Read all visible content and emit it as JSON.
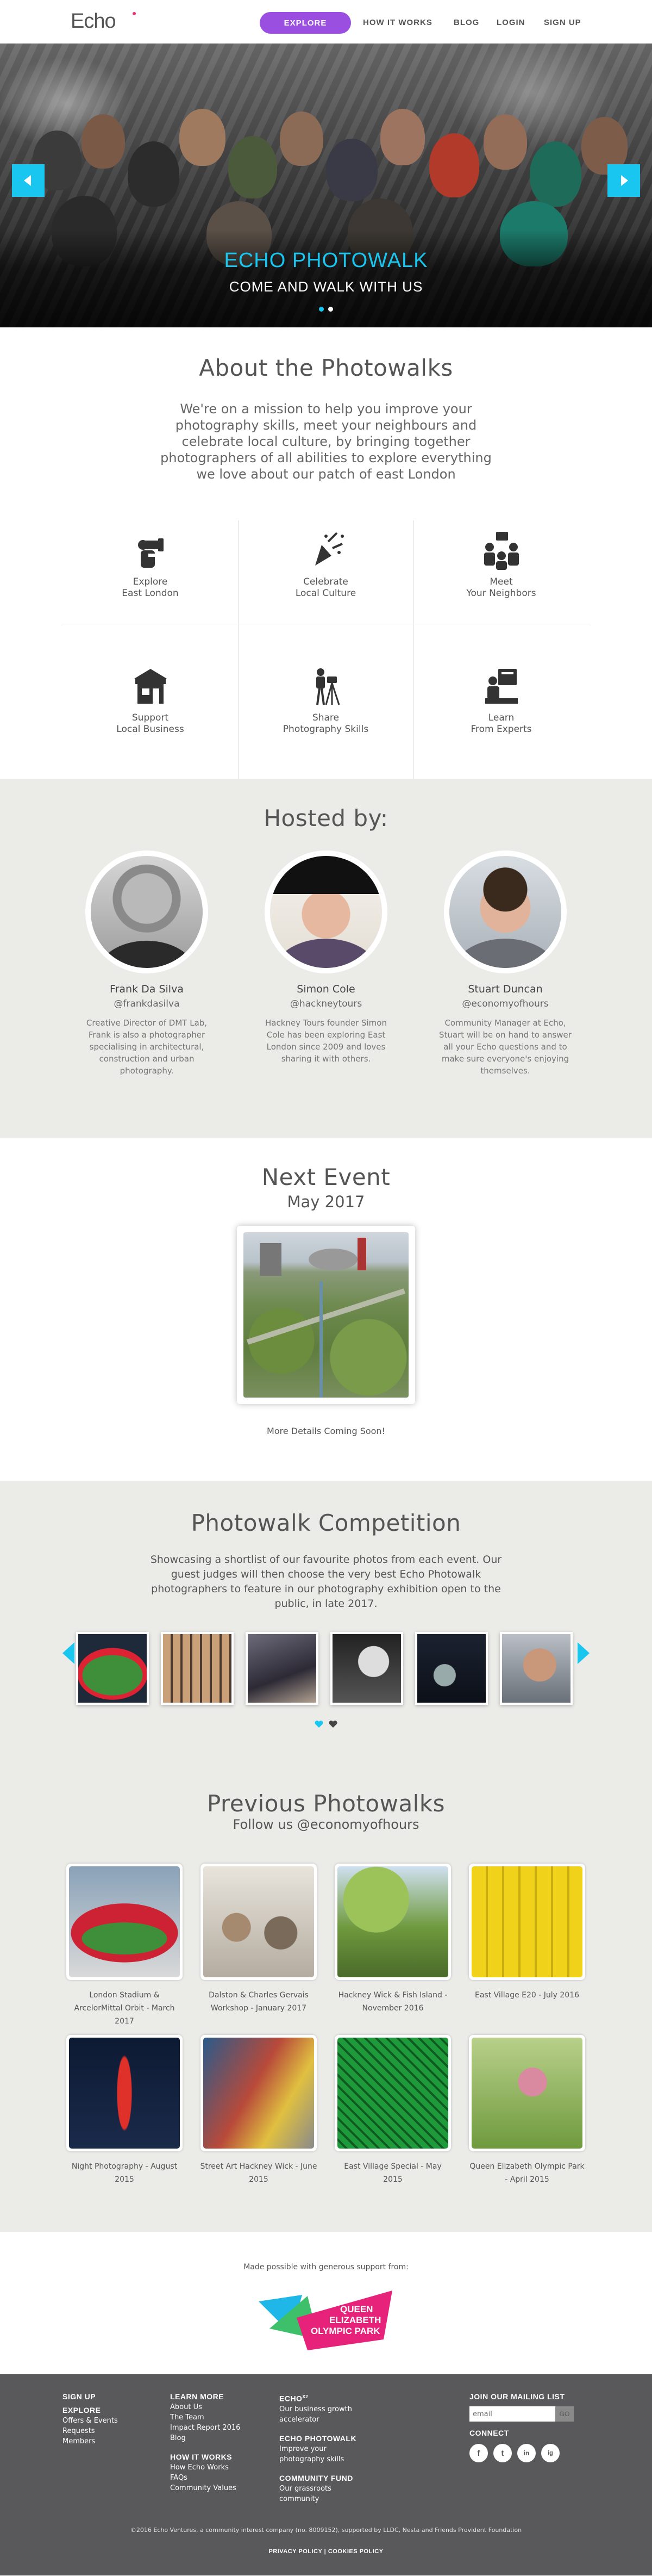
{
  "nav": {
    "logo": "Echo",
    "explore": "EXPLORE",
    "links": [
      "HOW IT WORKS",
      "BLOG",
      "LOGIN",
      "SIGN UP"
    ]
  },
  "hero": {
    "title": "ECHO PHOTOWALK",
    "subtitle": "COME AND WALK WITH US",
    "slide_count": 2,
    "active_slide": 1
  },
  "about": {
    "title": "About the Photowalks",
    "text": "We're on a mission to help you improve your photography skills, meet your neighbours and celebrate local culture, by bringing together photographers of all abilities to explore everything we love about our patch of east London",
    "features": [
      {
        "icon": "binoculars-icon",
        "label": "Explore\nEast London"
      },
      {
        "icon": "party-popper-icon",
        "label": "Celebrate\nLocal Culture"
      },
      {
        "icon": "neighbors-chat-icon",
        "label": "Meet\nYour Neighbors"
      },
      {
        "icon": "shopfront-icon",
        "label": "Support\nLocal Business"
      },
      {
        "icon": "tripod-camera-icon",
        "label": "Share\nPhotography Skills"
      },
      {
        "icon": "presenter-icon",
        "label": "Learn\nFrom Experts"
      }
    ]
  },
  "hosted": {
    "title": "Hosted by:",
    "hosts": [
      {
        "name": "Frank Da Silva",
        "handle": "@frankdasilva",
        "bio": "Creative Director of DMT Lab, Frank is also a photographer specialising in architectural, construction and urban photography."
      },
      {
        "name": "Simon Cole",
        "handle": "@hackneytours",
        "bio": "Hackney Tours founder Simon Cole has been exploring East London since 2009 and loves sharing it with others."
      },
      {
        "name": "Stuart Duncan",
        "handle": "@economyofhours",
        "bio": "Community Manager at Echo, Stuart will be on hand to answer all your Echo questions and to make sure everyone's enjoying themselves."
      }
    ]
  },
  "next_event": {
    "title": "Next Event",
    "month": "May 2017",
    "note": "More Details Coming Soon!"
  },
  "competition": {
    "title": "Photowalk Competition",
    "text": "Showcasing a shortlist of our favourite photos from each event. Our guest judges will then choose the very best Echo Photowalk photographers to feature in our photography exhibition open to the public, in late 2017.",
    "thumb_count": 7
  },
  "previous": {
    "title": "Previous Photowalks",
    "subtitle": "Follow us @economyofhours",
    "walks": [
      {
        "caption": "London Stadium & ArcelorMittal Orbit - March 2017"
      },
      {
        "caption": "Dalston & Charles Gervais Workshop - January 2017"
      },
      {
        "caption": "Hackney Wick & Fish Island - November 2016"
      },
      {
        "caption": "East Village E20 - July 2016"
      },
      {
        "caption": "Night Photography - August 2015"
      },
      {
        "caption": "Street Art Hackney Wick - June 2015"
      },
      {
        "caption": "East Village Special - May 2015"
      },
      {
        "caption": "Queen Elizabeth Olympic Park - April 2015"
      }
    ]
  },
  "support": {
    "text": "Made possible with generous support from:",
    "sponsor_lines": [
      "QUEEN",
      "ELIZABETH",
      "OLYMPIC PARK"
    ]
  },
  "footer": {
    "col1": {
      "head1": "SIGN UP",
      "head2": "EXPLORE",
      "items": [
        "Offers & Events",
        "Requests",
        "Members"
      ]
    },
    "col2": {
      "head1": "LEARN MORE",
      "items1": [
        "About Us",
        "The Team",
        "Impact Report 2016",
        "Blog"
      ],
      "head2": "HOW IT WORKS",
      "items2": [
        "How Echo Works",
        "FAQs",
        "Community Values"
      ]
    },
    "col3": {
      "head1": "ECHO",
      "head1_sup": "X2",
      "text1": "Our business growth accelerator",
      "head2": "ECHO PHOTOWALK",
      "text2": "Improve your photography skills",
      "head3": "COMMUNITY FUND",
      "text3": "Our grassroots community"
    },
    "col4": {
      "head1": "JOIN OUR MAILING LIST",
      "placeholder": "email",
      "go": "GO",
      "head2": "CONNECT",
      "socials": [
        "f",
        "t",
        "in",
        "ig"
      ]
    },
    "copyright": "©2016 Echo Ventures, a community interest company (no. 8009152), supported by LLDC, Nesta and Friends Provident Foundation",
    "policy": "PRIVACY POLICY | COOKIES POLICY"
  }
}
